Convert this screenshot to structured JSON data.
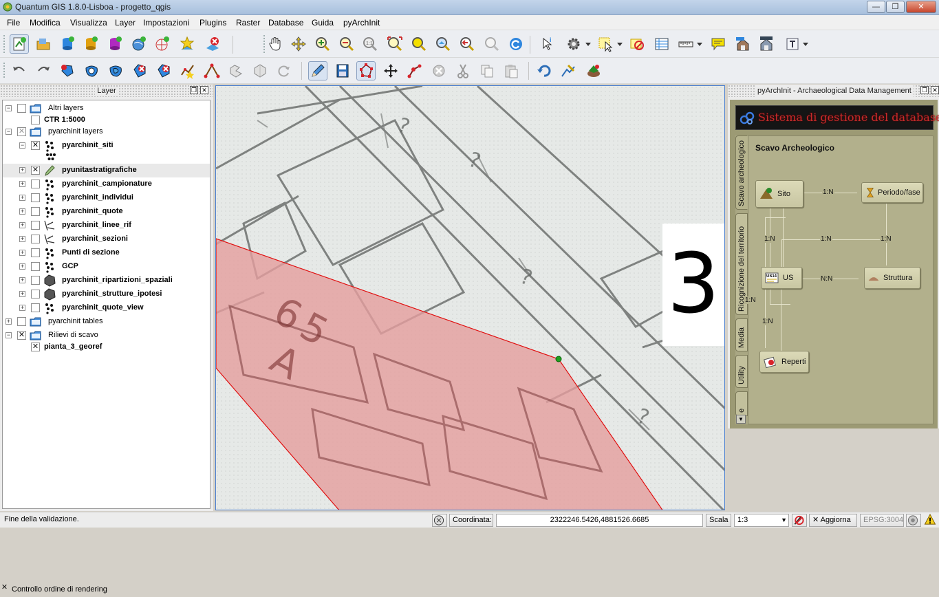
{
  "window": {
    "title": "Quantum GIS 1.8.0-Lisboa - progetto_qgis",
    "buttons": {
      "minimize": "—",
      "maximize": "❐",
      "close": "✕"
    }
  },
  "menubar": [
    "File",
    "Modifica",
    "Visualizza",
    "Layer",
    "Impostazioni",
    "Plugins",
    "Raster",
    "Database",
    "Guida",
    "pyArchInit"
  ],
  "toolbar_icons": {
    "row1": [
      "new-project-icon",
      "open-project-icon",
      "add-vector-icon",
      "add-raster-icon",
      "add-postgis-icon",
      "add-spatialite-icon",
      "add-wms-icon",
      "new-shapefile-icon",
      "remove-layer-icon",
      "pan-icon",
      "pan-to-selection-icon",
      "zoom-in-icon",
      "zoom-out-icon",
      "zoom-native-icon",
      "zoom-full-icon",
      "zoom-to-selection-icon",
      "zoom-to-layer-icon",
      "zoom-last-icon",
      "zoom-next-icon",
      "refresh-icon",
      "identify-icon",
      "action-icon",
      "select-icon",
      "deselect-icon",
      "attribute-table-icon",
      "measure-icon",
      "map-tips-icon",
      "new-bookmark-icon",
      "show-bookmarks-icon",
      "text-annotation-icon"
    ],
    "row2": [
      "undo-icon",
      "redo-icon",
      "add-ring-icon",
      "add-part-icon",
      "fill-ring-icon",
      "delete-ring-icon",
      "delete-part-icon",
      "reshape-icon",
      "offset-curve-icon",
      "split-features-icon",
      "merge-features-icon",
      "rotate-point-symbols-icon",
      "toggle-editing-icon",
      "save-edits-icon",
      "node-tool-icon",
      "move-feature-icon",
      "add-feature-icon",
      "delete-selected-icon",
      "cut-icon",
      "copy-icon",
      "paste-icon",
      "rotate-icon",
      "simplify-icon",
      "capture-icon"
    ]
  },
  "layer_panel": {
    "title": "Layer",
    "rows": [
      {
        "label": "Altri layers",
        "bold": false,
        "check": "",
        "icon": "group-folder-icon",
        "expander": "−"
      },
      {
        "label": "CTR 1:5000",
        "bold": true,
        "check": "",
        "icon": "",
        "expander": ""
      },
      {
        "label": "pyarchinit layers",
        "bold": false,
        "check": "✕",
        "icon": "group-folder-icon",
        "expander": "−"
      },
      {
        "label": "pyarchinit_siti",
        "bold": true,
        "check": "✕",
        "icon": "point-layer-icon",
        "expander": "−"
      },
      {
        "label": "pyunitastratigrafiche",
        "bold": true,
        "check": "✕",
        "icon": "edit-pencil-icon",
        "expander": "+"
      },
      {
        "label": "pyarchinit_campionature",
        "bold": true,
        "check": "",
        "icon": "point-layer-icon",
        "expander": "+"
      },
      {
        "label": "pyarchinit_individui",
        "bold": true,
        "check": "",
        "icon": "point-layer-icon",
        "expander": "+"
      },
      {
        "label": "pyarchinit_quote",
        "bold": true,
        "check": "",
        "icon": "point-layer-icon",
        "expander": "+"
      },
      {
        "label": "pyarchinit_linee_rif",
        "bold": true,
        "check": "",
        "icon": "line-layer-icon",
        "expander": "+"
      },
      {
        "label": "pyarchinit_sezioni",
        "bold": true,
        "check": "",
        "icon": "line-layer-icon",
        "expander": "+"
      },
      {
        "label": "Punti di sezione",
        "bold": true,
        "check": "",
        "icon": "point-layer-icon",
        "expander": "+"
      },
      {
        "label": "GCP",
        "bold": true,
        "check": "",
        "icon": "point-layer-icon",
        "expander": "+"
      },
      {
        "label": "pyarchinit_ripartizioni_spaziali",
        "bold": true,
        "check": "",
        "icon": "polygon-layer-icon",
        "expander": "+"
      },
      {
        "label": "pyarchinit_strutture_ipotesi",
        "bold": true,
        "check": "",
        "icon": "polygon-layer-icon",
        "expander": "+"
      },
      {
        "label": "pyarchinit_quote_view",
        "bold": true,
        "check": "",
        "icon": "point-layer-icon",
        "expander": "+"
      },
      {
        "label": "pyarchinit tables",
        "bold": false,
        "check": "",
        "icon": "group-folder-icon",
        "expander": "+"
      },
      {
        "label": "Rilievi di scavo",
        "bold": false,
        "check": "✕",
        "icon": "group-folder-icon",
        "expander": "−"
      },
      {
        "label": "pianta_3_georef",
        "bold": true,
        "check": "✕",
        "icon": "",
        "expander": ""
      }
    ],
    "render_order": {
      "label": "Controllo ordine di rendering",
      "check": "✕"
    }
  },
  "map": {
    "overlay_number": "3",
    "polygon_fill": "#e59e9e",
    "polygon_stroke": "#e01010",
    "vertex_color": "#1ea01e"
  },
  "pyarchinit_panel": {
    "title": "pyArchInit - Archaeological Data Management",
    "banner": "Sistema di gestione del database",
    "tabs": [
      "Scavo archeologico",
      "Ricognizione del territorio",
      "Media",
      "Utility",
      "e"
    ],
    "page_title": "Scavo Archeologico",
    "nodes": {
      "sito": "Sito",
      "periodo": "Periodo/fase",
      "us": "US",
      "struttura": "Struttura",
      "reperti": "Reperti"
    },
    "relations": {
      "sito_periodo": "1:N",
      "sito_us": "1:N",
      "us_periodo_mid": "1:N",
      "periodo_struttura": "1:N",
      "us_struttura": "N:N",
      "us_reperti": "1:N",
      "left_loop": "1:N"
    },
    "scroll_arrow": "▼"
  },
  "statusbar": {
    "message": "Fine della validazione.",
    "coord_label": "Coordinata:",
    "coord_value": "2322246.5426,4881526.6685",
    "scale_label": "Scala",
    "scale_value": "1:3",
    "render_label": "Aggiorna",
    "render_check": "✕",
    "crs": "EPSG:3004",
    "dropdown_arrow": "▼"
  }
}
